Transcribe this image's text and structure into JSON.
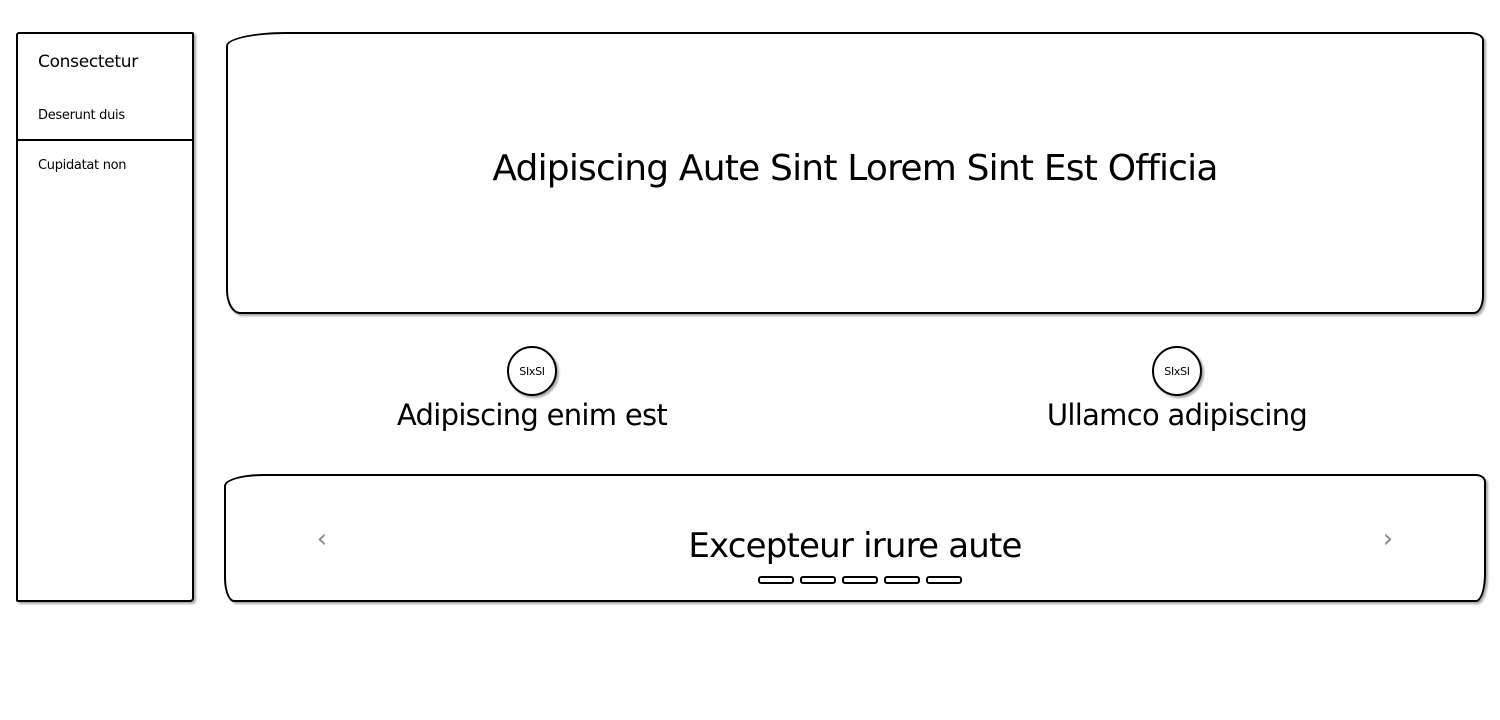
{
  "sidebar": {
    "title": "Consectetur",
    "items": [
      {
        "label": "Deserunt duis"
      },
      {
        "label": "Cupidatat non"
      }
    ]
  },
  "hero": {
    "title": "Adipiscing Aute Sint Lorem Sint Est Officia"
  },
  "features": [
    {
      "avatar_text": "SIxSI",
      "label": "Adipiscing enim est"
    },
    {
      "avatar_text": "SIxSI",
      "label": "Ullamco adipiscing"
    }
  ],
  "carousel": {
    "title": "Excepteur irure aute",
    "prev_icon": "chevron-left-icon",
    "next_icon": "chevron-right-icon",
    "prev_glyph": "‹",
    "next_glyph": "›",
    "slide_count": 5
  },
  "colors": {
    "border": "#000000",
    "arrow": "#888888",
    "background": "#ffffff"
  }
}
